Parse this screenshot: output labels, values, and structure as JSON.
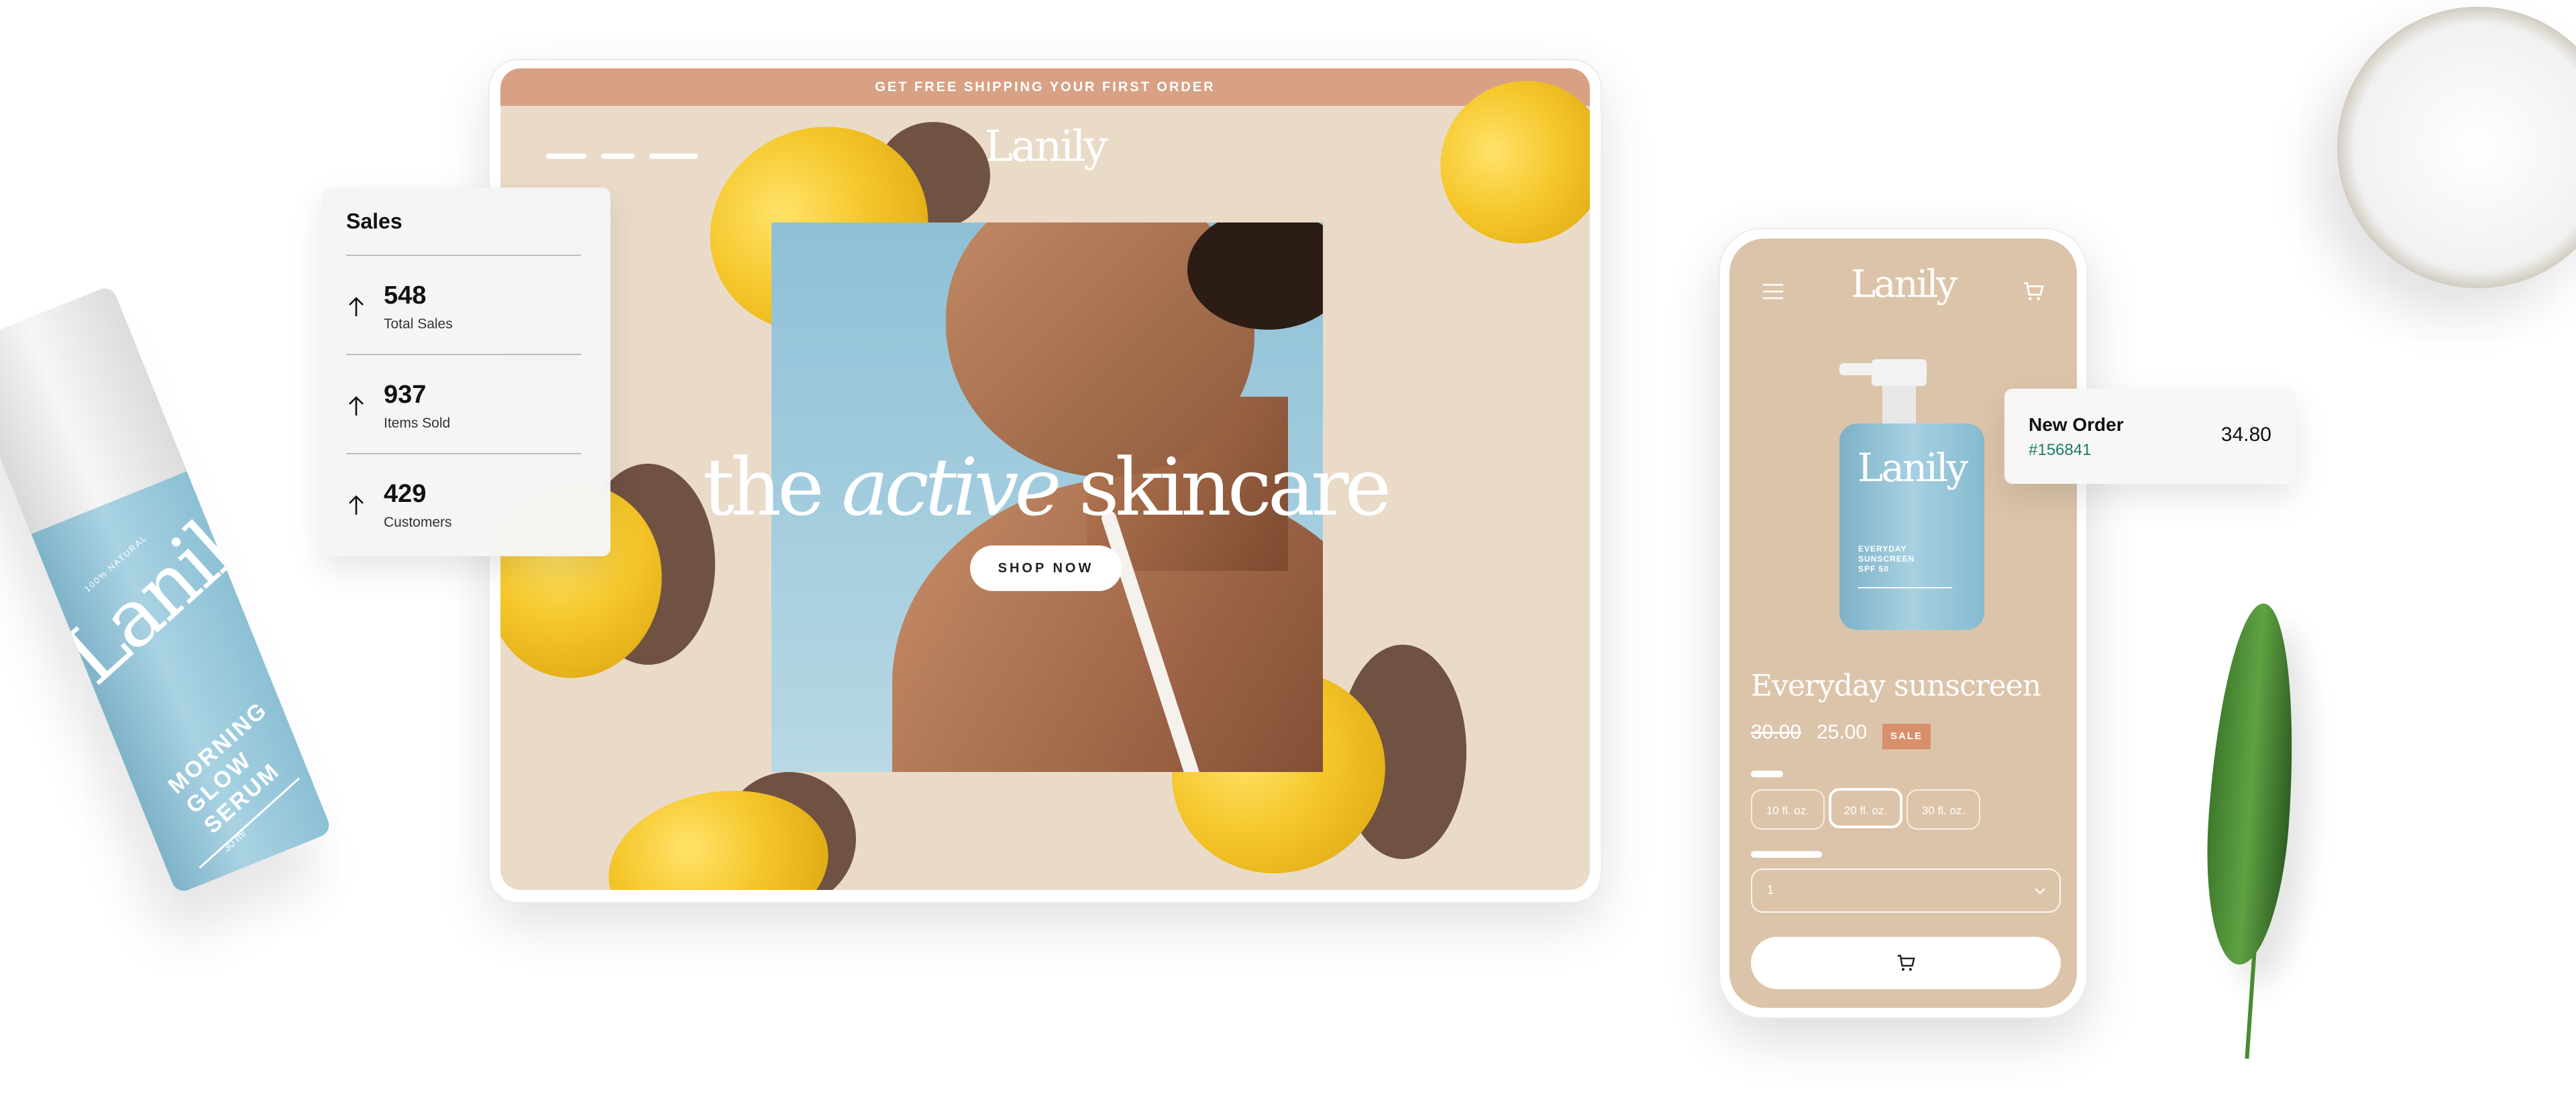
{
  "serum": {
    "tag": "100% NATURAL",
    "brand": "Lanily",
    "name_lines": [
      "MORNING",
      "GLOW",
      "SERUM"
    ],
    "size": "30 ml"
  },
  "tablet": {
    "promo_text": "GET FREE SHIPPING YOUR FIRST ORDER",
    "logo": "Lanily",
    "icons": [
      "search-icon",
      "cart-icon",
      "user-icon"
    ],
    "headline_pre": "the",
    "headline_em": "active",
    "headline_post": "skincare",
    "cta": "SHOP NOW"
  },
  "sales_card": {
    "title": "Sales",
    "stats": [
      {
        "value": "548",
        "label": "Total Sales",
        "icon": "arrow-up-icon"
      },
      {
        "value": "937",
        "label": "Items Sold",
        "icon": "arrow-up-icon"
      },
      {
        "value": "429",
        "label": "Customers",
        "icon": "arrow-up-icon"
      }
    ]
  },
  "phone": {
    "logo": "Lanily",
    "bottle_brand": "Lanily",
    "bottle_text": [
      "EVERYDAY",
      "SUNSCREEN",
      "SPF 50"
    ],
    "product_name": "Everyday sunscreen",
    "old_price": "30.00",
    "new_price": "25.00",
    "sale_badge": "SALE",
    "sizes": [
      {
        "label": "10 fl. oz.",
        "selected": false
      },
      {
        "label": "20 fl. oz.",
        "selected": true
      },
      {
        "label": "30 fl. oz.",
        "selected": false
      }
    ],
    "quantity": "1"
  },
  "order_card": {
    "title": "New Order",
    "order_id": "#156841",
    "amount": "34.80"
  },
  "colors": {
    "promo_bar": "#d8a184",
    "tablet_bg": "#eadbc9",
    "phone_bg": "#dcc4aa",
    "sale_badge": "#d8906c",
    "order_id": "#1c7c6a",
    "bottle_blue": "#8cc0d4"
  }
}
